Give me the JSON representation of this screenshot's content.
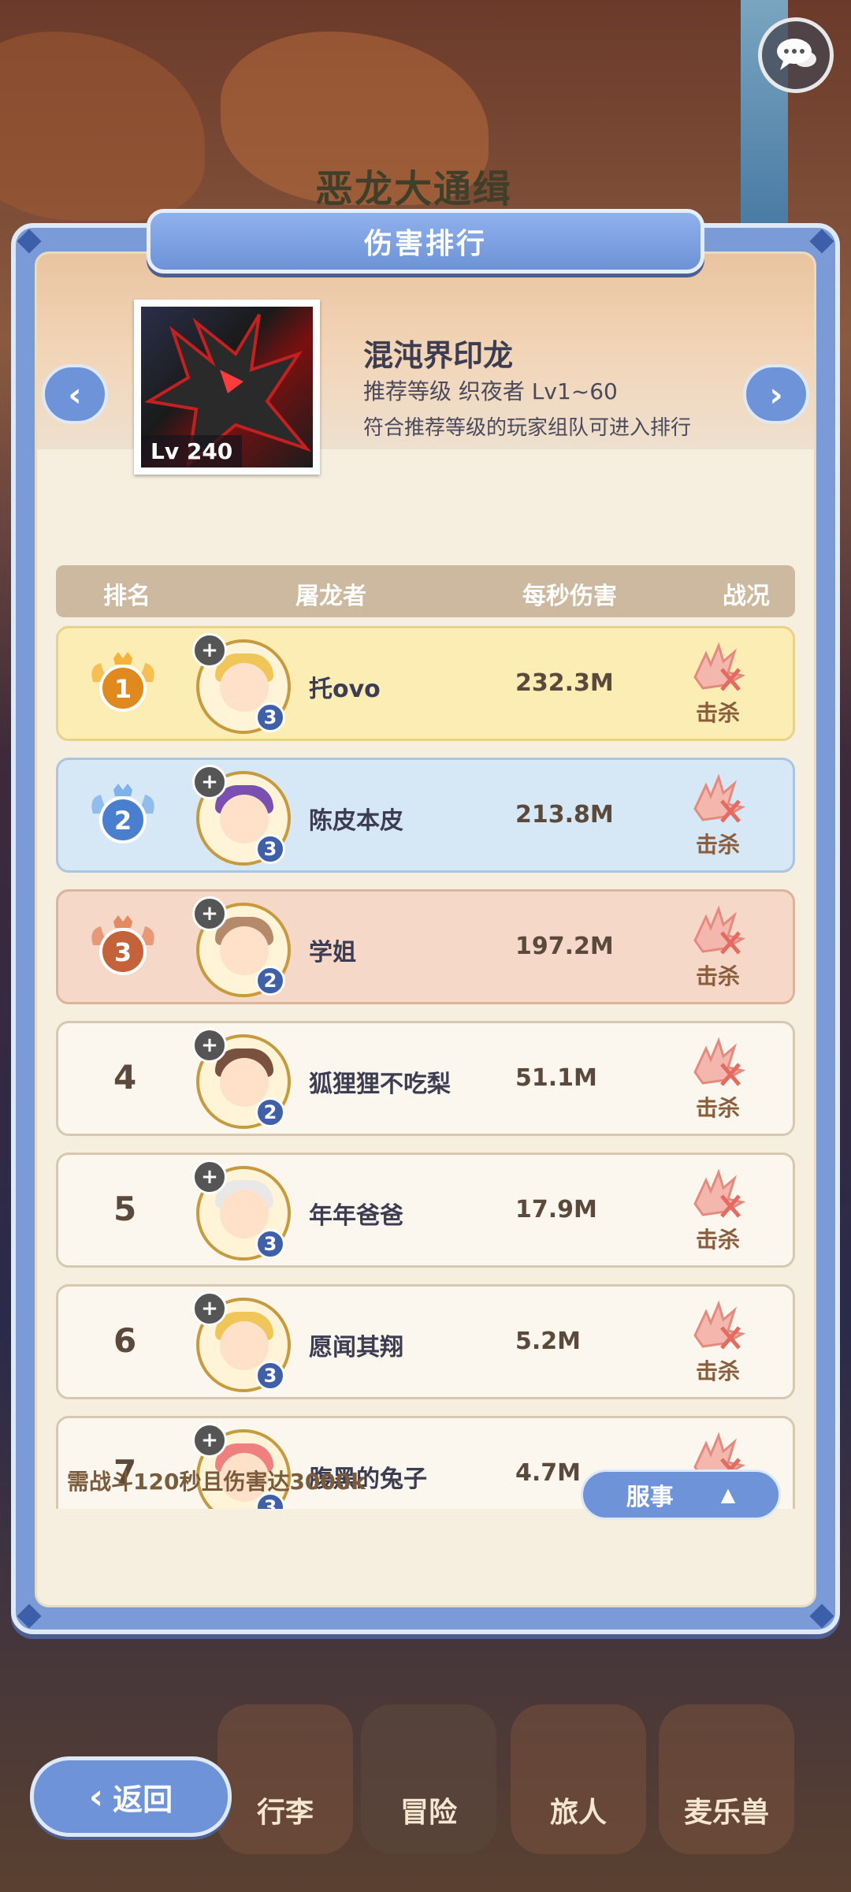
{
  "background": {
    "title_text": "恶龙大通缉"
  },
  "panel": {
    "title": "伤害排行"
  },
  "boss": {
    "name": "混沌界印龙",
    "level": "Lv 240",
    "recommend": "推荐等级 织夜者  Lv1~60",
    "note": "符合推荐等级的玩家组队可进入排行"
  },
  "table": {
    "headers": {
      "rank": "排名",
      "slayer": "屠龙者",
      "dps": "每秒伤害",
      "status": "战况"
    },
    "rows": [
      {
        "rank": "1",
        "name": "托ovo",
        "dps": "232.3M",
        "status": "击杀",
        "stars": "3",
        "hair": "#f1c658"
      },
      {
        "rank": "2",
        "name": "陈皮本皮",
        "dps": "213.8M",
        "status": "击杀",
        "stars": "3",
        "hair": "#7a4fb0"
      },
      {
        "rank": "3",
        "name": "学姐",
        "dps": "197.2M",
        "status": "击杀",
        "stars": "2",
        "hair": "#b48a6a"
      },
      {
        "rank": "4",
        "name": "狐狸狸不吃梨",
        "dps": "51.1M",
        "status": "击杀",
        "stars": "2",
        "hair": "#7a5040"
      },
      {
        "rank": "5",
        "name": "年年爸爸",
        "dps": "17.9M",
        "status": "击杀",
        "stars": "3",
        "hair": "#e8e8e8"
      },
      {
        "rank": "6",
        "name": "愿闻其翔",
        "dps": "5.2M",
        "status": "击杀",
        "stars": "3",
        "hair": "#f1c658"
      },
      {
        "rank": "7",
        "name": "腹黑的兔子",
        "dps": "4.7M",
        "status": "击杀",
        "stars": "3",
        "hair": "#f08080"
      }
    ]
  },
  "footer": {
    "requirement": "需战斗120秒且伤害达3000k",
    "server_label": "服事"
  },
  "nav": {
    "back_label": "返回",
    "tabs": [
      "行李",
      "冒险",
      "旅人",
      "麦乐兽"
    ]
  },
  "colors": {
    "accent_blue": "#6f93d8",
    "gold_row": "#fcedb5",
    "silver_row": "#d6e7f6",
    "bronze_row": "#f5d8c8"
  }
}
